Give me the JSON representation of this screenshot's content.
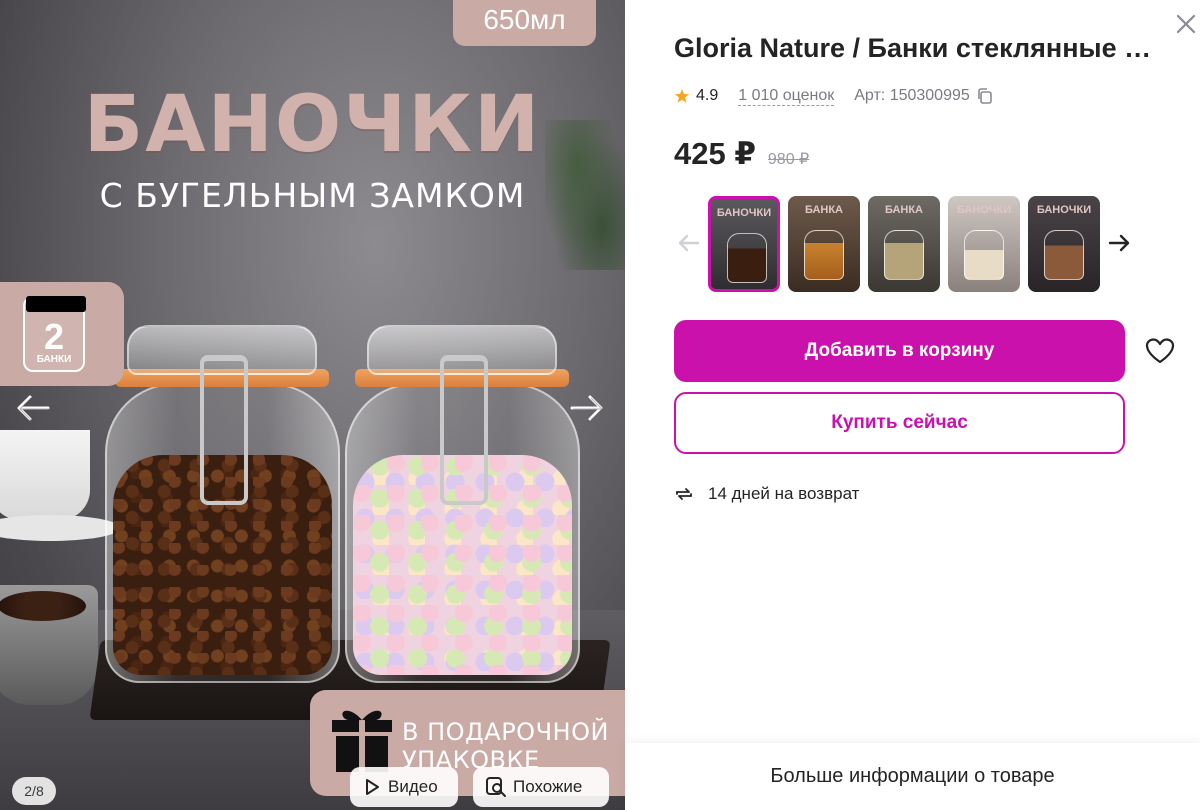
{
  "gallery": {
    "volume": "650мл",
    "headline": "БАНОЧКИ",
    "subheadline": "С БУГЕЛЬНЫМ ЗАМКОМ",
    "badge_number": "2",
    "badge_label": "БАНКИ",
    "gift_line1": "В ПОДАРОЧНОЙ",
    "gift_line2": "УПАКОВКЕ",
    "page_counter": "2/8",
    "video_label": "Видео",
    "similar_label": "Похожие"
  },
  "product": {
    "title": "Gloria Nature / Банки стеклянные для хранения с бугельным замком",
    "rating": "4.9",
    "reviews": "1 010 оценок",
    "article": "Арт: 150300995",
    "price_now": "425 ₽",
    "price_old": "980 ₽"
  },
  "thumbnails": [
    {
      "title": "БАНОЧКИ",
      "active": true
    },
    {
      "title": "БАНКА",
      "active": false
    },
    {
      "title": "БАНКА",
      "active": false
    },
    {
      "title": "БАНОЧКИ",
      "active": false
    },
    {
      "title": "БАНОЧКИ",
      "active": false
    }
  ],
  "actions": {
    "add_to_cart": "Добавить в корзину",
    "buy_now": "Купить сейчас"
  },
  "returns": {
    "text": "14 дней на возврат"
  },
  "footer": {
    "more_info": "Больше информации о товаре"
  },
  "colors": {
    "accent": "#cb11ab",
    "rose_badge": "#c9aaa5",
    "star": "#f6a623"
  }
}
